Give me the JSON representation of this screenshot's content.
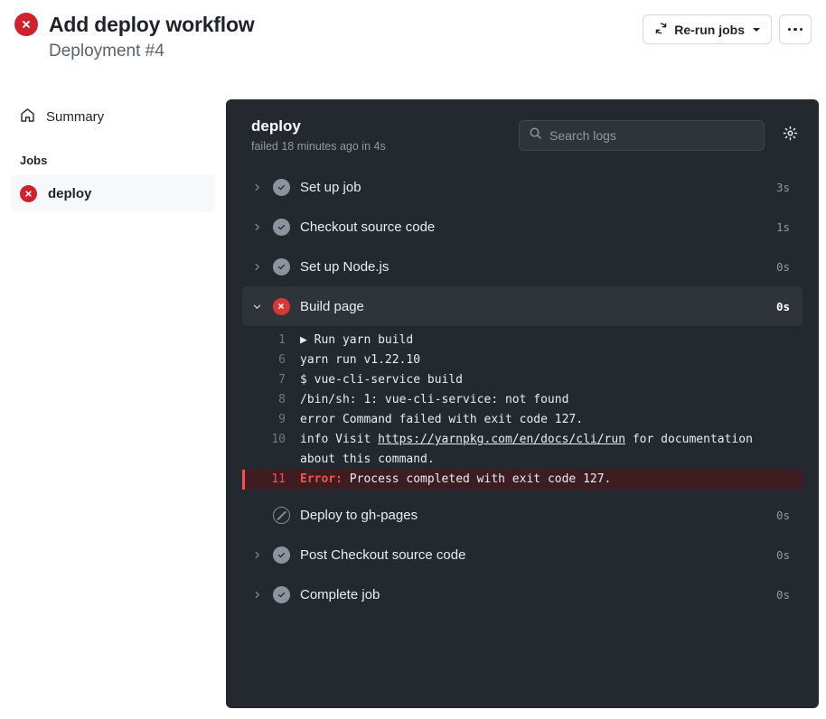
{
  "header": {
    "status_icon": "x-circle-fill-icon",
    "title": "Add deploy workflow",
    "subtitle": "Deployment #4",
    "rerun_button": {
      "label": "Re-run jobs",
      "icon": "sync-icon",
      "caret": "chevron-down-icon"
    },
    "more_button": {
      "icon": "kebab-horizontal-icon"
    }
  },
  "sidebar": {
    "summary": {
      "label": "Summary",
      "icon": "home-icon"
    },
    "jobs_section_label": "Jobs",
    "jobs": [
      {
        "label": "deploy",
        "status": "failure",
        "icon": "x-circle-fill-icon",
        "selected": true
      }
    ]
  },
  "log_panel": {
    "job_name": "deploy",
    "job_meta": "failed 18 minutes ago in 4s",
    "search": {
      "placeholder": "Search logs",
      "value": "",
      "icon": "search-icon"
    },
    "settings_icon": "gear-icon",
    "steps": [
      {
        "label": "Set up job",
        "duration": "3s",
        "status": "success",
        "icon": "check-circle-fill-icon",
        "chevron": "chevron-right-icon",
        "expanded": false,
        "active": false
      },
      {
        "label": "Checkout source code",
        "duration": "1s",
        "status": "success",
        "icon": "check-circle-fill-icon",
        "chevron": "chevron-right-icon",
        "expanded": false,
        "active": false
      },
      {
        "label": "Set up Node.js",
        "duration": "0s",
        "status": "success",
        "icon": "check-circle-fill-icon",
        "chevron": "chevron-right-icon",
        "expanded": false,
        "active": false
      },
      {
        "label": "Build page",
        "duration": "0s",
        "status": "failure",
        "icon": "x-circle-fill-icon",
        "chevron": "chevron-down-icon",
        "expanded": true,
        "active": true
      },
      {
        "label": "Deploy to gh-pages",
        "duration": "0s",
        "status": "skipped",
        "icon": "skip-circle-icon",
        "chevron": "",
        "expanded": false,
        "active": false
      },
      {
        "label": "Post Checkout source code",
        "duration": "0s",
        "status": "success",
        "icon": "check-circle-fill-icon",
        "chevron": "chevron-right-icon",
        "expanded": false,
        "active": false
      },
      {
        "label": "Complete job",
        "duration": "0s",
        "status": "success",
        "icon": "check-circle-fill-icon",
        "chevron": "chevron-right-icon",
        "expanded": false,
        "active": false
      }
    ],
    "log_lines": [
      {
        "number": "1",
        "prefix": "▶ ",
        "text": "Run yarn build",
        "kind": "group"
      },
      {
        "number": "6",
        "prefix": "",
        "text": "yarn run v1.22.10",
        "kind": "normal"
      },
      {
        "number": "7",
        "prefix": "",
        "text": "$ vue-cli-service build",
        "kind": "normal"
      },
      {
        "number": "8",
        "prefix": "",
        "text": "/bin/sh: 1: vue-cli-service: not found",
        "kind": "normal"
      },
      {
        "number": "9",
        "prefix": "",
        "text": "error Command failed with exit code 127.",
        "kind": "normal"
      },
      {
        "number": "10",
        "prefix": "",
        "text_before": "info Visit ",
        "link": "https://yarnpkg.com/en/docs/cli/run",
        "text_after": " for documentation about this command.",
        "kind": "link"
      },
      {
        "number": "11",
        "prefix": "",
        "tag": "Error:",
        "text": " Process completed with exit code 127.",
        "kind": "error"
      }
    ]
  },
  "colors": {
    "failure_red": "#cf222e",
    "panel_bg": "#24292f",
    "error_row_bg": "#3d1d20",
    "error_text": "#f85149",
    "success_gray": "#8b949e"
  }
}
